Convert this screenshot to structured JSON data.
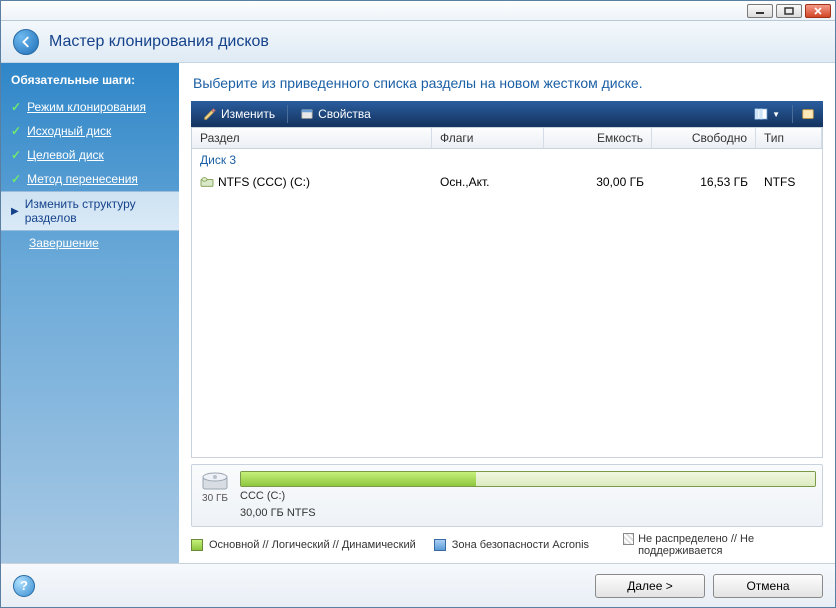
{
  "window": {
    "title": "Мастер клонирования дисков"
  },
  "sidebar": {
    "heading": "Обязательные шаги:",
    "items": [
      {
        "label": "Режим клонирования",
        "done": true
      },
      {
        "label": "Исходный диск",
        "done": true
      },
      {
        "label": "Целевой диск",
        "done": true
      },
      {
        "label": "Метод перенесения",
        "done": true
      },
      {
        "label": "Изменить структуру разделов",
        "active": true
      },
      {
        "label": "Завершение",
        "done": false
      }
    ]
  },
  "main": {
    "instruction": "Выберите из приведенного списка разделы на новом жестком диске.",
    "toolbar": {
      "edit": "Изменить",
      "properties": "Свойства"
    },
    "columns": {
      "partition": "Раздел",
      "flags": "Флаги",
      "capacity": "Емкость",
      "free": "Свободно",
      "type": "Тип"
    },
    "group": "Диск 3",
    "row": {
      "partition": "NTFS (CCC) (C:)",
      "flags": "Осн.,Акт.",
      "capacity": "30,00 ГБ",
      "free": "16,53 ГБ",
      "type": "NTFS"
    },
    "diskmap": {
      "size": "30 ГБ",
      "line1": "CCC (C:)",
      "line2": "30,00 ГБ  NTFS"
    },
    "legend": {
      "primary": "Основной // Логический // Динамический",
      "zone": "Зона безопасности Acronis",
      "unalloc": "Не распределено // Не поддерживается"
    }
  },
  "footer": {
    "next": "Далее >",
    "cancel": "Отмена"
  }
}
